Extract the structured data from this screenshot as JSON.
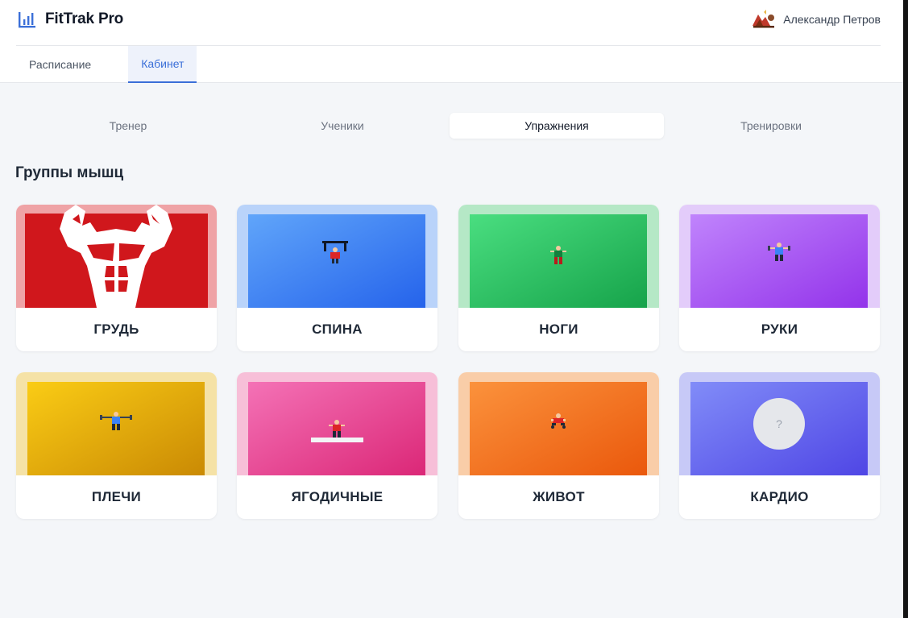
{
  "app": {
    "name": "FitTrak Pro",
    "logo_icon": "bar-chart-icon",
    "accent_color": "#3b6fd8"
  },
  "user": {
    "name": "Александр Петров",
    "avatar_icon": "user-avatar-icon"
  },
  "main_tabs": [
    {
      "label": "Расписание",
      "active": false
    },
    {
      "label": "Кабинет",
      "active": true
    }
  ],
  "sub_tabs": [
    {
      "label": "Тренер",
      "active": false
    },
    {
      "label": "Ученики",
      "active": false
    },
    {
      "label": "Упражнения",
      "active": true
    },
    {
      "label": "Тренировки",
      "active": false
    }
  ],
  "section": {
    "title": "Группы мышц"
  },
  "muscle_groups": [
    {
      "label": "ГРУДЬ",
      "icon": "chest-muscles-icon",
      "color": "#d0171c"
    },
    {
      "label": "СПИНА",
      "icon": "pullup-figure-icon",
      "color": "#3b82f6"
    },
    {
      "label": "НОГИ",
      "icon": "standing-figure-icon",
      "color": "#22c55e"
    },
    {
      "label": "РУКИ",
      "icon": "arms-figure-icon",
      "color": "#a855f7"
    },
    {
      "label": "ПЛЕЧИ",
      "icon": "shoulders-figure-icon",
      "color": "#eab308"
    },
    {
      "label": "ЯГОДИЧНЫЕ",
      "icon": "bench-figure-icon",
      "color": "#ec4899"
    },
    {
      "label": "ЖИВОТ",
      "icon": "crunch-figure-icon",
      "color": "#f97316"
    },
    {
      "label": "КАРДИО",
      "icon": "question-mark-icon",
      "placeholder_text": "?",
      "color": "#6366f1"
    }
  ]
}
